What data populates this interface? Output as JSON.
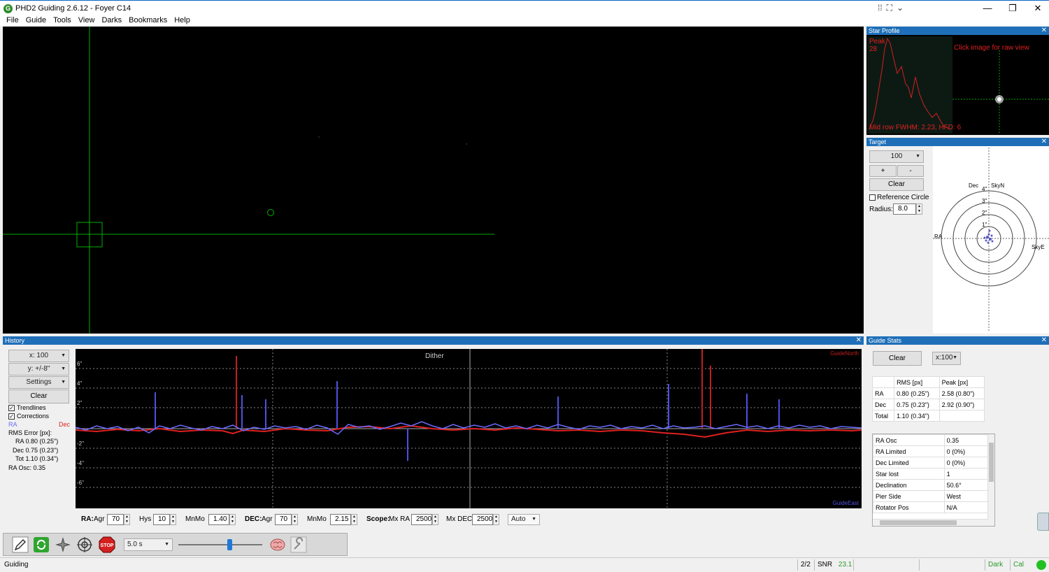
{
  "window": {
    "title": "PHD2 Guiding 2.6.12 - Foyer C14",
    "app_icon_letter": "G"
  },
  "menu": [
    "File",
    "Guide",
    "Tools",
    "View",
    "Darks",
    "Bookmarks",
    "Help"
  ],
  "star_profile": {
    "title": "Star Profile",
    "peak_label": "Peak",
    "peak_value": "28",
    "click_hint": "Click image for raw view",
    "fwhm_text": "Mid row FWHM: 2.23, HFD: 6"
  },
  "target": {
    "title": "Target",
    "scale_value": "100",
    "plus_label": "+",
    "minus_label": "-",
    "clear_label": "Clear",
    "ref_circle_label": "Reference Circle",
    "radius_label": "Radius:",
    "radius_value": "8.0",
    "dec_label": "Dec",
    "skyn_label": "SkyN",
    "ra_label": "RA",
    "skye_label": "SkyE",
    "ring_labels": [
      "4\"",
      "3\"",
      "2\"",
      "1\""
    ]
  },
  "history": {
    "title": "History",
    "x_combo": "x: 100",
    "y_combo": "y: +/-8\"",
    "settings_label": "Settings",
    "clear_label": "Clear",
    "trendlines_label": "Trendlines",
    "corrections_label": "Corrections",
    "ra_legend": "RA",
    "dec_legend": "Dec",
    "rms_title": "RMS Error [px]:",
    "rms_ra": "RA  0.80 (0.25\")",
    "rms_dec": "Dec  0.75 (0.23\")",
    "rms_tot": "Tot  1.10 (0.34\")",
    "ra_osc": "RA Osc: 0.35",
    "dither_label": "Dither",
    "guide_north": "GuideNorth",
    "guide_east": "GuideEast",
    "y_ticks": [
      "6\"",
      "4\"",
      "2\"",
      "-2\"",
      "-4\"",
      "-6\""
    ]
  },
  "params": {
    "ra_label": "RA:",
    "ra_agr_label": "Agr",
    "ra_agr": "70",
    "hys_label": "Hys",
    "hys": "10",
    "ra_mnmo_label": "MnMo",
    "ra_mnmo": "1.40",
    "dec_label": "DEC:",
    "dec_agr_label": "Agr",
    "dec_agr": "70",
    "dec_mnmo_label": "MnMo",
    "dec_mnmo": "2.15",
    "scope_label": "Scope:",
    "mx_ra_label": "Mx RA",
    "mx_ra": "2500",
    "mx_dec_label": "Mx DEC",
    "mx_dec": "2500",
    "dec_mode": "Auto"
  },
  "guide_stats": {
    "title": "Guide Stats",
    "clear_label": "Clear",
    "scale_combo": "x:100",
    "rms_header": [
      "",
      "RMS [px]",
      "Peak [px]"
    ],
    "rms_rows": [
      [
        "RA",
        "0.80 (0.25\")",
        "2.58 (0.80\")"
      ],
      [
        "Dec",
        "0.75 (0.23\")",
        "2.92 (0.90\")"
      ],
      [
        "Total",
        "1.10 (0.34\")",
        ""
      ]
    ],
    "info_rows": [
      [
        "RA Osc",
        "0.35"
      ],
      [
        "RA Limited",
        "0 (0%)"
      ],
      [
        "Dec Limited",
        "0 (0%)"
      ],
      [
        "Star lost",
        "1"
      ],
      [
        "Declination",
        "50.6°"
      ],
      [
        "Pier Side",
        "West"
      ],
      [
        "Rotator Pos",
        "N/A"
      ]
    ]
  },
  "toolbar": {
    "exposure": "5.0 s",
    "stop_label": "STOP"
  },
  "status": {
    "state": "Guiding",
    "frames": "2/2",
    "snr_label": "SNR",
    "snr_value": "23.1",
    "dark_label": "Dark",
    "cal_label": "Cal"
  },
  "colors": {
    "ra": "#6b6bff",
    "dec": "#e02020",
    "grid": "#00c000",
    "header": "#1e6fb8"
  }
}
